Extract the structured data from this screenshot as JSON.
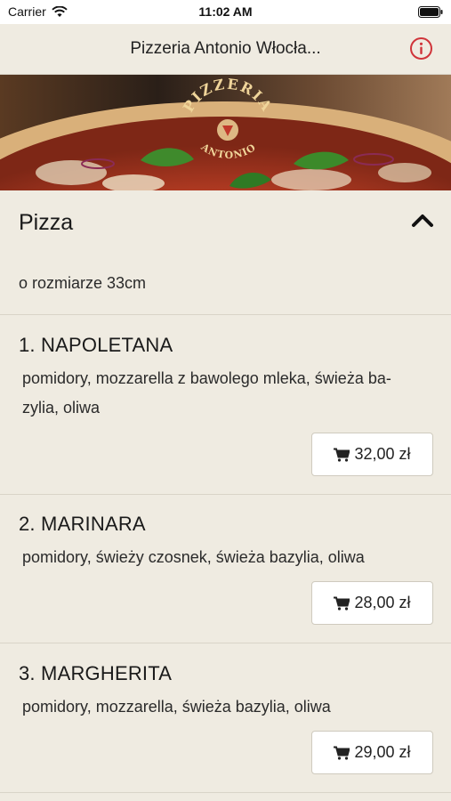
{
  "status": {
    "carrier": "Carrier",
    "time": "11:02 AM"
  },
  "nav": {
    "title": "Pizzeria Antonio Włocła..."
  },
  "hero": {
    "logo_top": "PIZZERIA",
    "logo_bottom": "ANTONIO"
  },
  "section": {
    "title": "Pizza",
    "subtitle": "o rozmiarze 33cm"
  },
  "items": [
    {
      "name": "1. NAPOLETANA",
      "desc_line1": " pomidory, mozzarella z bawolego mleka, świeża ba-",
      "desc_line2": "zylia, oliwa",
      "price": "32,00 zł"
    },
    {
      "name": "2. MARINARA",
      "desc_line1": " pomidory, świeży czosnek, świeża bazylia, oliwa",
      "price": "28,00 zł"
    },
    {
      "name": "3. MARGHERITA",
      "desc_line1": " pomidory, mozzarella, świeża bazylia, oliwa",
      "price": "29,00 zł"
    }
  ],
  "colors": {
    "background": "#efebe1",
    "accent": "#d0343a"
  }
}
